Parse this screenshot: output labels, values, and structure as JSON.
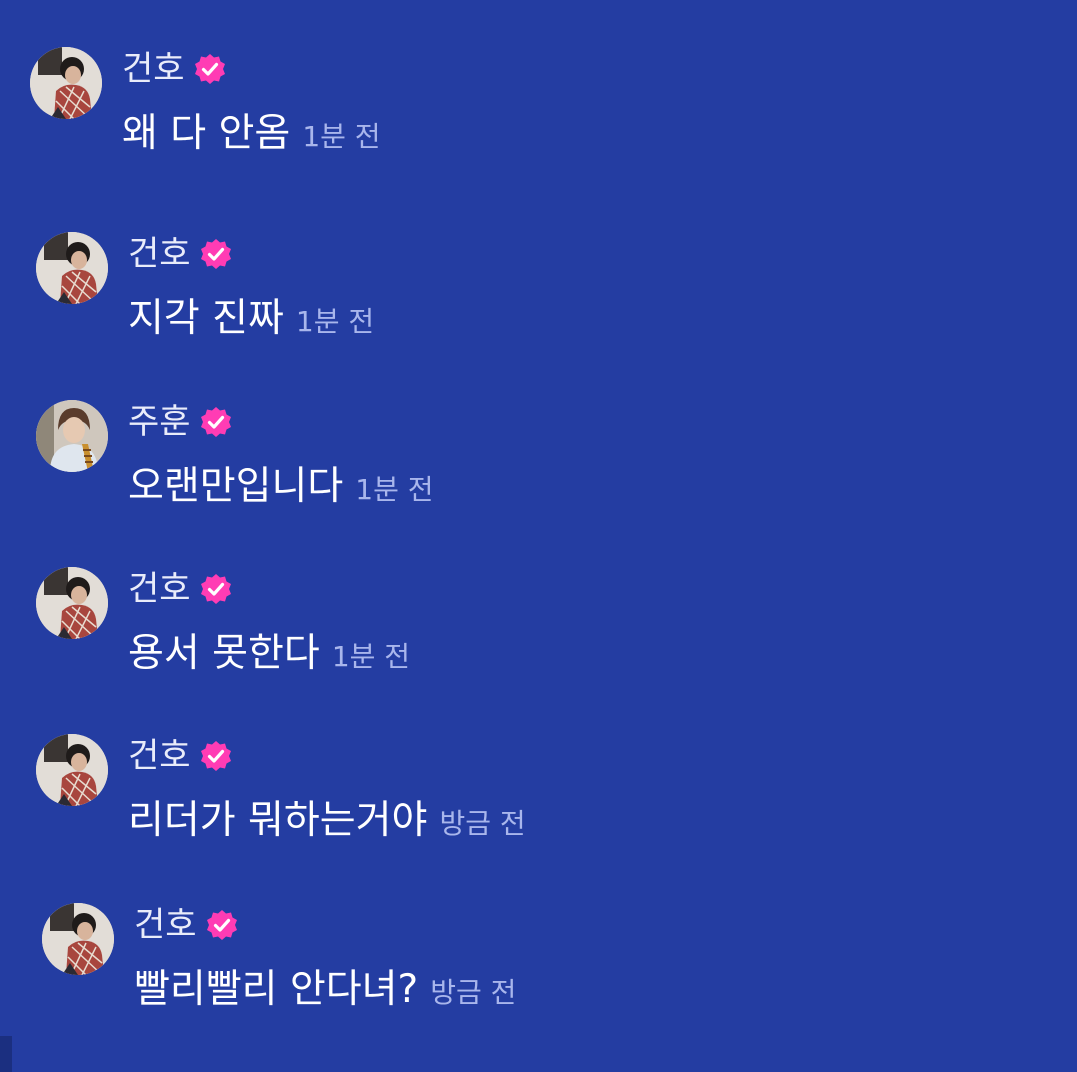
{
  "colors": {
    "background": "#243da2",
    "verified_badge": "#ff3cb4",
    "timestamp": "#a9b6ec"
  },
  "messages": [
    {
      "avatar": "avatar-geonho",
      "name": "건호",
      "badge": "verified-badge-icon",
      "text": "왜 다 안옴",
      "time": "1분 전"
    },
    {
      "avatar": "avatar-geonho",
      "name": "건호",
      "badge": "verified-badge-icon",
      "text": "지각 진짜",
      "time": "1분 전"
    },
    {
      "avatar": "avatar-juhun",
      "name": "주훈",
      "badge": "verified-badge-icon",
      "text": "오랜만입니다",
      "time": "1분 전"
    },
    {
      "avatar": "avatar-geonho",
      "name": "건호",
      "badge": "verified-badge-icon",
      "text": "용서 못한다",
      "time": "1분 전"
    },
    {
      "avatar": "avatar-geonho",
      "name": "건호",
      "badge": "verified-badge-icon",
      "text": "리더가 뭐하는거야",
      "time": "방금 전"
    },
    {
      "avatar": "avatar-geonho",
      "name": "건호",
      "badge": "verified-badge-icon",
      "text": "빨리빨리 안다녀?",
      "time": "방금 전"
    }
  ]
}
